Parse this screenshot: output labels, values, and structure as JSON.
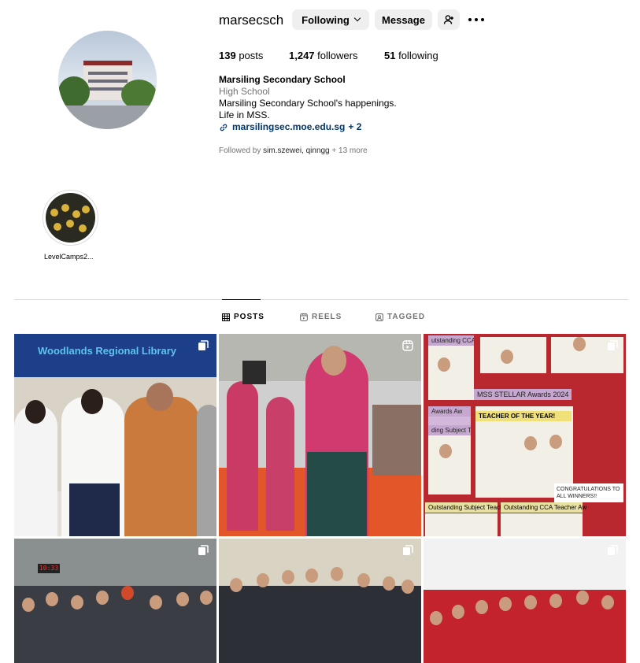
{
  "profile": {
    "username": "marsecsch",
    "following_label": "Following",
    "message_label": "Message",
    "stats": {
      "posts": "139",
      "posts_label": "posts",
      "followers": "1,247",
      "followers_label": "followers",
      "following": "51",
      "following_label": "following"
    },
    "bio": {
      "name": "Marsiling Secondary School",
      "category": "High School",
      "line1": "Marsiling Secondary School's happenings.",
      "line2": "Life in MSS.",
      "link": "marsilingsec.moe.edu.sg",
      "link_more": "+ 2"
    },
    "followed_by": {
      "prefix": "Followed by",
      "names": "sim.szewei, qinngg",
      "more": "+ 13 more"
    }
  },
  "highlights": [
    {
      "label": "LevelCamps2..."
    }
  ],
  "tabs": {
    "posts": "POSTS",
    "reels": "REELS",
    "tagged": "TAGGED",
    "active": "posts"
  },
  "posts": [
    {
      "sign_text": "Woodlands Regional Library",
      "badge": "carousel-icon"
    },
    {
      "badge": "reel-icon"
    },
    {
      "badge": "carousel-icon",
      "banner": "MSS STELLAR Awards 2024",
      "teacher": "TEACHER OF THE YEAR!",
      "awards": "Awards Aw",
      "subject": "ding Subject Te",
      "cca_top": "utstanding CCA Tea",
      "subject_bottom": "Outstanding Subject Teacher A",
      "cca_bottom": "Outstanding CCA Teacher Aw",
      "note": "CONGRATULATIONS TO ALL WINNERS!!"
    },
    {
      "badge": "carousel-icon",
      "clock": "10:33"
    },
    {
      "badge": "carousel-icon"
    },
    {
      "badge": "carousel-icon"
    }
  ],
  "colors": {
    "link": "#00376b",
    "muted": "#737373",
    "button_bg": "#efefef"
  }
}
